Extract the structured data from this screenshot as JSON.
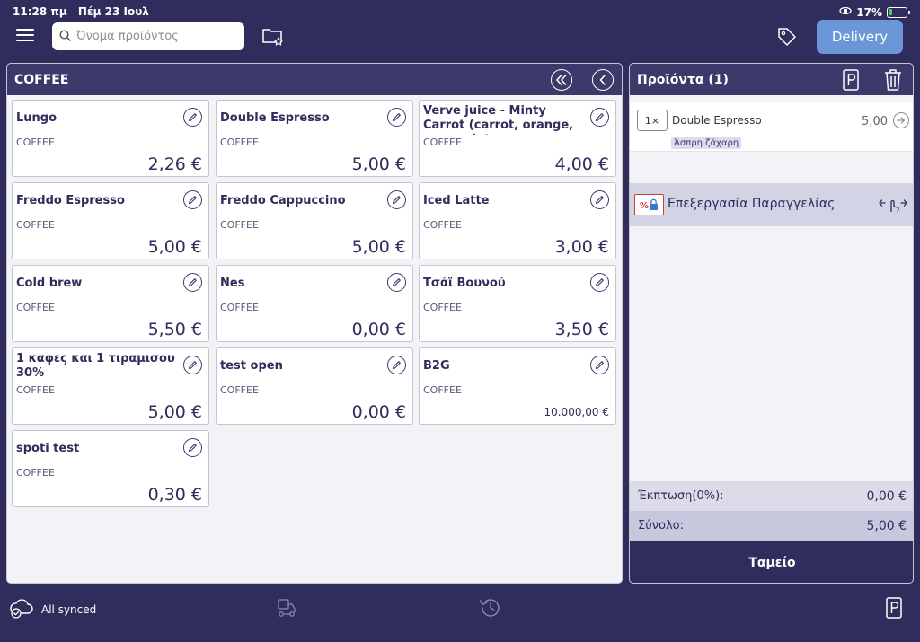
{
  "status_bar": {
    "time": "11:28 πμ",
    "date": "Πέμ 23 Ιουλ",
    "battery": "17%"
  },
  "header": {
    "search_placeholder": "Όνομα προϊόντος",
    "delivery_label": "Delivery"
  },
  "products_panel": {
    "category_title": "COFFEE",
    "products": [
      {
        "name": "Lungo",
        "category": "COFFEE",
        "price": "2,26 €"
      },
      {
        "name": "Double Espresso",
        "category": "COFFEE",
        "price": "5,00 €"
      },
      {
        "name": "Verve juice - Minty Carrot (carrot, orange, spearmint,",
        "category": "COFFEE",
        "price": "4,00 €"
      },
      {
        "name": "Freddo Espresso",
        "category": "COFFEE",
        "price": "5,00 €"
      },
      {
        "name": "Freddo Cappuccino",
        "category": "COFFEE",
        "price": "5,00 €"
      },
      {
        "name": "Iced Latte",
        "category": "COFFEE",
        "price": "3,00 €"
      },
      {
        "name": "Cold brew",
        "category": "COFFEE",
        "price": "5,50 €"
      },
      {
        "name": "Nes",
        "category": "COFFEE",
        "price": "0,00 €"
      },
      {
        "name": "Τσάϊ Βουνού",
        "category": "COFFEE",
        "price": "3,50 €"
      },
      {
        "name": "1 καφες και 1 τιραμισου 30%",
        "category": "COFFEE",
        "price": "5,00 €"
      },
      {
        "name": "test open",
        "category": "COFFEE",
        "price": "0,00 €"
      },
      {
        "name": "B2G",
        "category": "COFFEE",
        "price": "10.000,00 €"
      },
      {
        "name": "spoti test",
        "category": "COFFEE",
        "price": "0,30 €"
      }
    ]
  },
  "order_panel": {
    "title": "Προϊόντα (1)",
    "line": {
      "qty": "1×",
      "name": "Double Espresso",
      "price": "5,00",
      "modifier": "Άσπρη ζάχαρη"
    },
    "processing_label": "Επεξεργασία Παραγγελίας",
    "discount_label": "Έκπτωση(0%):",
    "discount_value": "0,00 €",
    "total_label": "Σύνολο:",
    "total_value": "5,00 €",
    "checkout_label": "Ταμείο"
  },
  "footer": {
    "sync_status": "All synced"
  }
}
